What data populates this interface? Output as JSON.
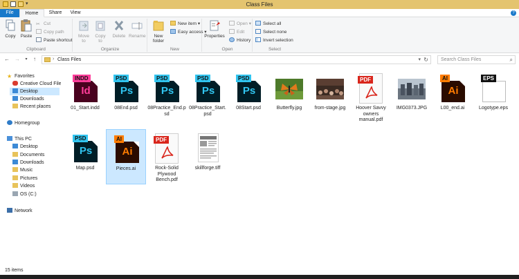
{
  "window": {
    "title": "Class Files"
  },
  "tabs": [
    {
      "label": "File"
    },
    {
      "label": "Home"
    },
    {
      "label": "Share"
    },
    {
      "label": "View"
    }
  ],
  "help_label": "?",
  "ribbon": {
    "clipboard": {
      "label": "Clipboard",
      "copy": "Copy",
      "paste": "Paste",
      "cut": "Cut",
      "copy_path": "Copy path",
      "paste_shortcut": "Paste shortcut"
    },
    "organize": {
      "label": "Organize",
      "move_to": "Move to",
      "copy_to": "Copy to",
      "delete": "Delete",
      "rename": "Rename"
    },
    "new": {
      "label": "New",
      "new_folder": "New folder",
      "new_item": "New item",
      "easy_access": "Easy access"
    },
    "open": {
      "label": "Open",
      "properties": "Properties",
      "open": "Open",
      "edit": "Edit",
      "history": "History"
    },
    "select": {
      "label": "Select",
      "select_all": "Select all",
      "select_none": "Select none",
      "invert": "Invert selection"
    }
  },
  "address": {
    "crumb": "Class Files",
    "search_placeholder": "Search Class Files"
  },
  "nav": [
    {
      "label": "Favorites"
    },
    {
      "label": "Creative Cloud Files"
    },
    {
      "label": "Desktop"
    },
    {
      "label": "Downloads"
    },
    {
      "label": "Recent places"
    },
    {
      "label": "Homegroup"
    },
    {
      "label": "This PC"
    },
    {
      "label": "Desktop"
    },
    {
      "label": "Documents"
    },
    {
      "label": "Downloads"
    },
    {
      "label": "Music"
    },
    {
      "label": "Pictures"
    },
    {
      "label": "Videos"
    },
    {
      "label": "OS (C:)"
    },
    {
      "label": "Network"
    }
  ],
  "files": [
    {
      "name": "01_Start.indd",
      "kind": "indd",
      "tag": "INDD",
      "letter": "Id"
    },
    {
      "name": "08End.psd",
      "kind": "psd",
      "tag": "PSD",
      "letter": "Ps"
    },
    {
      "name": "08Practice_End.psd",
      "kind": "psd",
      "tag": "PSD",
      "letter": "Ps"
    },
    {
      "name": "08Practice_Start.psd",
      "kind": "psd",
      "tag": "PSD",
      "letter": "Ps"
    },
    {
      "name": "08Start.psd",
      "kind": "psd",
      "tag": "PSD",
      "letter": "Ps"
    },
    {
      "name": "Butterfly.jpg",
      "kind": "photo-butterfly"
    },
    {
      "name": "from-stage.jpg",
      "kind": "photo-stage"
    },
    {
      "name": "Hoover Savvy owners manual.pdf",
      "kind": "pdf",
      "tag": "PDF"
    },
    {
      "name": "IMG0373.JPG",
      "kind": "photo-img"
    },
    {
      "name": "L00_end.ai",
      "kind": "ai",
      "tag": "AI",
      "letter": "Ai"
    },
    {
      "name": "Logotype.eps",
      "kind": "eps",
      "tag": "EPS"
    },
    {
      "name": "Map.psd",
      "kind": "psd",
      "tag": "PSD",
      "letter": "Ps"
    },
    {
      "name": "Pieces.ai",
      "kind": "ai",
      "tag": "AI",
      "letter": "Ai",
      "selected": true
    },
    {
      "name": "Rock-Solid Plywood Bench.pdf",
      "kind": "pdf",
      "tag": "PDF"
    },
    {
      "name": "skillforge.tiff",
      "kind": "tiff"
    }
  ],
  "status": {
    "count": "15 items"
  },
  "colors": {
    "accent": "#1979ca",
    "selection": "#cce8ff",
    "titlebar": "#e4c46f"
  }
}
